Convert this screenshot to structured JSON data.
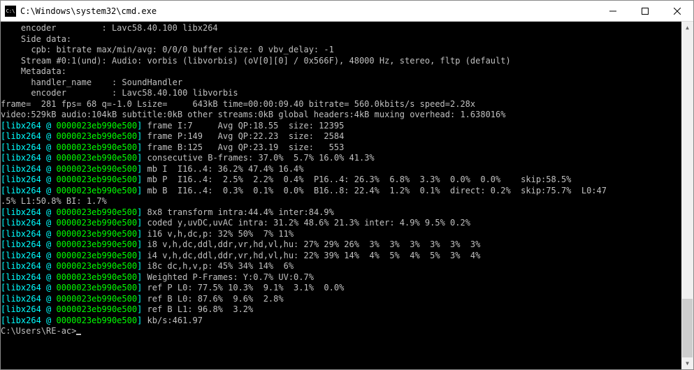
{
  "window": {
    "title": "C:\\Windows\\system32\\cmd.exe"
  },
  "terminal": {
    "plain_lines_top": [
      "    encoder         : Lavc58.40.100 libx264",
      "    Side data:",
      "      cpb: bitrate max/min/avg: 0/0/0 buffer size: 0 vbv_delay: -1",
      "    Stream #0:1(und): Audio: vorbis (libvorbis) (oV[0][0] / 0x566F), 48000 Hz, stereo, fltp (default)",
      "    Metadata:",
      "      handler_name    : SoundHandler",
      "      encoder         : Lavc58.40.100 libvorbis",
      "frame=  281 fps= 68 q=-1.0 Lsize=     643kB time=00:00:09.40 bitrate= 560.0kbits/s speed=2.28x",
      "video:529kB audio:104kB subtitle:0kB other streams:0kB global headers:4kB muxing overhead: 1.638016%"
    ],
    "tag_lines": [
      {
        "tag_a": "libx264 @ ",
        "tag_b": "0000023eb990e500",
        "rest": " frame I:7     Avg QP:18.55  size: 12395"
      },
      {
        "tag_a": "libx264 @ ",
        "tag_b": "0000023eb990e500",
        "rest": " frame P:149   Avg QP:22.23  size:  2584"
      },
      {
        "tag_a": "libx264 @ ",
        "tag_b": "0000023eb990e500",
        "rest": " frame B:125   Avg QP:23.19  size:   553"
      },
      {
        "tag_a": "libx264 @ ",
        "tag_b": "0000023eb990e500",
        "rest": " consecutive B-frames: 37.0%  5.7% 16.0% 41.3%"
      },
      {
        "tag_a": "libx264 @ ",
        "tag_b": "0000023eb990e500",
        "rest": " mb I  I16..4: 36.2% 47.4% 16.4%"
      },
      {
        "tag_a": "libx264 @ ",
        "tag_b": "0000023eb990e500",
        "rest": " mb P  I16..4:  2.5%  2.2%  0.4%  P16..4: 26.3%  6.8%  3.3%  0.0%  0.0%    skip:58.5%"
      },
      {
        "tag_a": "libx264 @ ",
        "tag_b": "0000023eb990e500",
        "rest": " mb B  I16..4:  0.3%  0.1%  0.0%  B16..8: 22.4%  1.2%  0.1%  direct: 0.2%  skip:75.7%  L0:47",
        "wrap": ".5% L1:50.8% BI: 1.7%"
      },
      {
        "tag_a": "libx264 @ ",
        "tag_b": "0000023eb990e500",
        "rest": " 8x8 transform intra:44.4% inter:84.9%"
      },
      {
        "tag_a": "libx264 @ ",
        "tag_b": "0000023eb990e500",
        "rest": " coded y,uvDC,uvAC intra: 31.2% 48.6% 21.3% inter: 4.9% 9.5% 0.2%"
      },
      {
        "tag_a": "libx264 @ ",
        "tag_b": "0000023eb990e500",
        "rest": " i16 v,h,dc,p: 32% 50%  7% 11%"
      },
      {
        "tag_a": "libx264 @ ",
        "tag_b": "0000023eb990e500",
        "rest": " i8 v,h,dc,ddl,ddr,vr,hd,vl,hu: 27% 29% 26%  3%  3%  3%  3%  3%  3%"
      },
      {
        "tag_a": "libx264 @ ",
        "tag_b": "0000023eb990e500",
        "rest": " i4 v,h,dc,ddl,ddr,vr,hd,vl,hu: 22% 39% 14%  4%  5%  4%  5%  3%  4%"
      },
      {
        "tag_a": "libx264 @ ",
        "tag_b": "0000023eb990e500",
        "rest": " i8c dc,h,v,p: 45% 34% 14%  6%"
      },
      {
        "tag_a": "libx264 @ ",
        "tag_b": "0000023eb990e500",
        "rest": " Weighted P-Frames: Y:0.7% UV:0.7%"
      },
      {
        "tag_a": "libx264 @ ",
        "tag_b": "0000023eb990e500",
        "rest": " ref P L0: 77.5% 10.3%  9.1%  3.1%  0.0%"
      },
      {
        "tag_a": "libx264 @ ",
        "tag_b": "0000023eb990e500",
        "rest": " ref B L0: 87.6%  9.6%  2.8%"
      },
      {
        "tag_a": "libx264 @ ",
        "tag_b": "0000023eb990e500",
        "rest": " ref B L1: 96.8%  3.2%"
      },
      {
        "tag_a": "libx264 @ ",
        "tag_b": "0000023eb990e500",
        "rest": " kb/s:461.97"
      }
    ],
    "prompt": "C:\\Users\\RE-ac>"
  }
}
